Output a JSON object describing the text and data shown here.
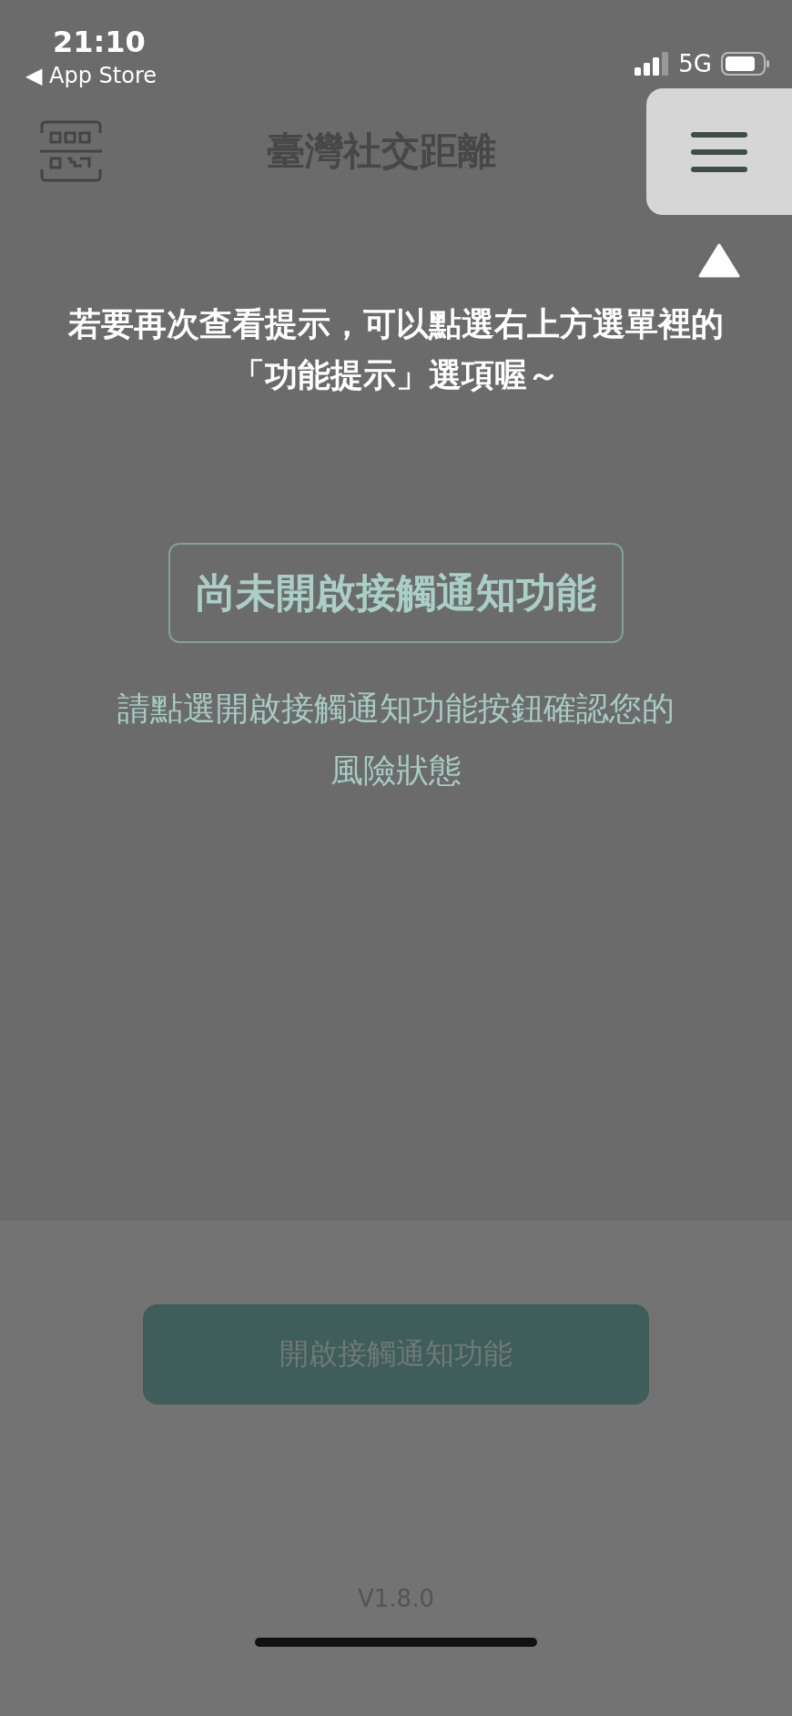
{
  "status_bar": {
    "time": "21:10",
    "back_link": "◀ App Store",
    "network": "5G"
  },
  "header": {
    "title": "臺灣社交距離"
  },
  "tip": {
    "lines": [
      "若要再次查看提示，可以點選右上方選單裡的",
      "「功能提示」選項喔～"
    ]
  },
  "status": {
    "label": "尚未開啟接觸通知功能",
    "description_lines": [
      "請點選開啟接觸通知功能按鈕確認您的",
      "風險狀態"
    ]
  },
  "enable_button": {
    "label": "開啟接觸通知功能"
  },
  "version": "V1.8.0"
}
